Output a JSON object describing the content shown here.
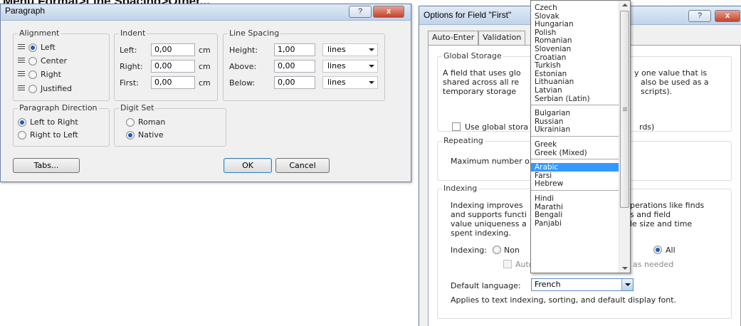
{
  "heading": "Menu Format>Line Spacing>Other...",
  "paragraph_dialog": {
    "title": "Paragraph",
    "help_button": "?",
    "close_button": "x",
    "alignment": {
      "title": "Alignment",
      "options": [
        "Left",
        "Center",
        "Right",
        "Justified"
      ],
      "selected": "Left"
    },
    "indent": {
      "title": "Indent",
      "rows": [
        {
          "label": "Left:",
          "value": "0,00",
          "unit": "cm"
        },
        {
          "label": "Right:",
          "value": "0,00",
          "unit": "cm"
        },
        {
          "label": "First:",
          "value": "0,00",
          "unit": "cm"
        }
      ]
    },
    "line_spacing": {
      "title": "Line Spacing",
      "rows": [
        {
          "label": "Height:",
          "value": "1,00",
          "unit": "lines"
        },
        {
          "label": "Above:",
          "value": "0,00",
          "unit": "lines"
        },
        {
          "label": "Below:",
          "value": "0,00",
          "unit": "lines"
        }
      ]
    },
    "direction": {
      "title": "Paragraph Direction",
      "options": [
        "Left to Right",
        "Right to Left"
      ],
      "selected": "Left to Right"
    },
    "digit_set": {
      "title": "Digit Set",
      "options": [
        "Roman",
        "Native"
      ],
      "selected": "Native"
    },
    "tabs_button": "Tabs...",
    "ok_button": "OK",
    "cancel_button": "Cancel"
  },
  "options_dialog": {
    "title": "Options for Field \"First\"",
    "help_button": "?",
    "close_button": "x",
    "tabs": [
      "Auto-Enter",
      "Validation"
    ],
    "global_storage": {
      "title": "Global Storage",
      "left_lines": [
        "A field that uses glo",
        "shared across all re",
        "temporary storage"
      ],
      "right_lines": [
        "y one value that is",
        "also be used as a",
        "scripts)."
      ],
      "checkbox_left": "Use global stora",
      "checkbox_right": "rds)"
    },
    "repeating": {
      "title": "Repeating",
      "text": "Maximum number o"
    },
    "indexing": {
      "title": "Indexing",
      "left_lines": [
        "Indexing improves",
        "and supports functi",
        "value uniqueness a",
        "spent indexing."
      ],
      "right_lines": [
        "perations like finds",
        "s and field",
        "le size and time"
      ],
      "indexing_label": "Indexing:",
      "none_option": "Non",
      "all_option": "All",
      "auto_option": "Auto",
      "auto_suffix": "as needed",
      "default_language_label": "Default language:",
      "default_language_value": "French",
      "note": "Applies to text indexing, sorting, and default display font."
    }
  },
  "language_dropdown": {
    "groups": [
      [
        "Czech",
        "Slovak",
        "Hungarian",
        "Polish",
        "Romanian",
        "Slovenian",
        "Croatian",
        "Turkish",
        "Estonian",
        "Lithuanian",
        "Latvian",
        "Serbian (Latin)"
      ],
      [
        "Bulgarian",
        "Russian",
        "Ukrainian"
      ],
      [
        "Greek",
        "Greek (Mixed)"
      ],
      [
        "Arabic",
        "Farsi",
        "Hebrew"
      ],
      [
        "Hindi",
        "Marathi",
        "Bengali",
        "Panjabi"
      ]
    ],
    "highlighted": "Arabic"
  },
  "colors": {
    "highlight": "#3399ff",
    "radio_dot": "#1c5db7",
    "close_red": "#c4432c"
  }
}
